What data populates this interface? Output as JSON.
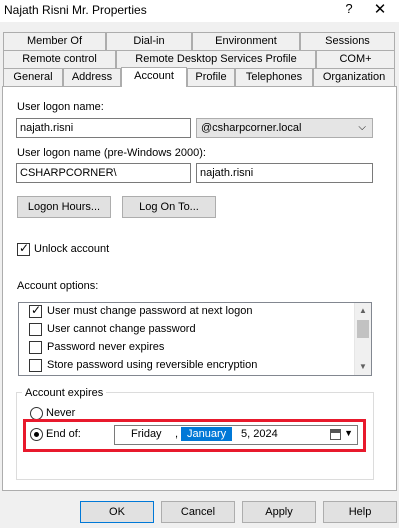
{
  "window": {
    "title": "Najath Risni Mr. Properties",
    "help_glyph": "?",
    "close_glyph": "✕"
  },
  "tabs": {
    "row1": [
      "Member Of",
      "Dial-in",
      "Environment",
      "Sessions"
    ],
    "row2": [
      "Remote control",
      "Remote Desktop Services Profile",
      "COM+"
    ],
    "row3": [
      "General",
      "Address",
      "Account",
      "Profile",
      "Telephones",
      "Organization"
    ],
    "active": "Account"
  },
  "account": {
    "logon_name_label": "User logon name:",
    "logon_name_value": "najath.risni",
    "domain_value": "@csharpcorner.local",
    "pre2000_label": "User logon name (pre-Windows 2000):",
    "pre2000_domain": "CSHARPCORNER\\",
    "pre2000_user": "najath.risni",
    "logon_hours_label": "Logon Hours...",
    "log_on_to_label": "Log On To...",
    "unlock_label": "Unlock account",
    "unlock_checked": true,
    "options_label": "Account options:",
    "options": [
      {
        "label": "User must change password at next logon",
        "checked": true
      },
      {
        "label": "User cannot change password",
        "checked": false
      },
      {
        "label": "Password never expires",
        "checked": false
      },
      {
        "label": "Store password using reversible encryption",
        "checked": false
      }
    ],
    "expires_label": "Account expires",
    "never_label": "Never",
    "end_of_label": "End of:",
    "date": {
      "weekday": "Friday",
      "sep1": ",",
      "month": "January",
      "rest": "5, 2024"
    }
  },
  "footer": {
    "ok": "OK",
    "cancel": "Cancel",
    "apply": "Apply",
    "help": "Help"
  },
  "colors": {
    "highlight": "#e8192c",
    "selection": "#0078d7"
  }
}
